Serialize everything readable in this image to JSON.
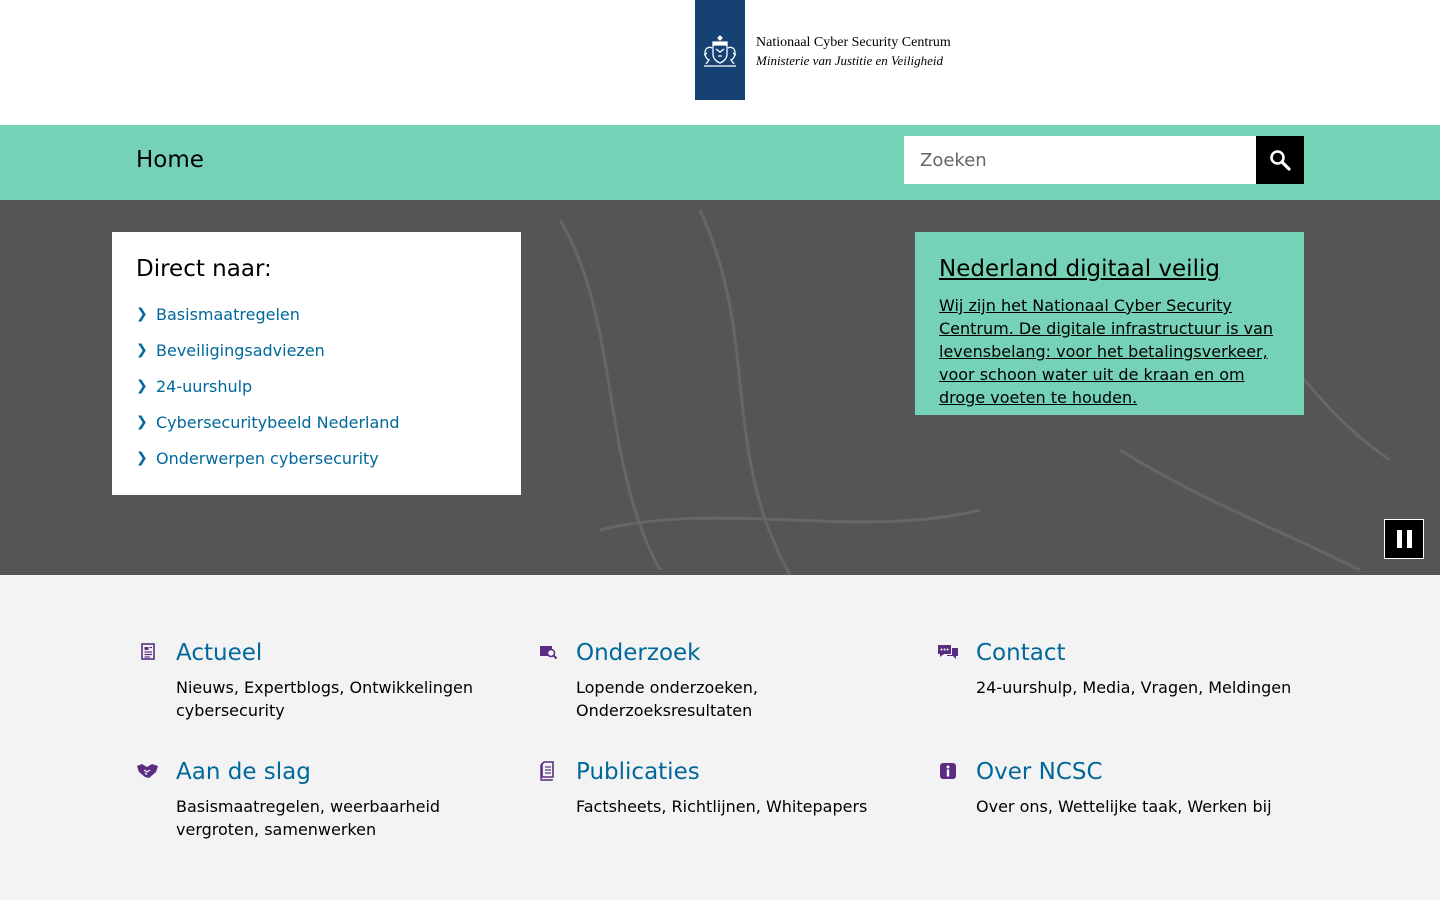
{
  "header": {
    "logo_name": "Nationaal Cyber Security Centrum",
    "logo_ministry": "Ministerie van Justitie en Veiligheid",
    "brand_color": "#154273"
  },
  "nav": {
    "home_label": "Home",
    "search_placeholder": "Zoeken",
    "accent_color": "#76d2b6"
  },
  "direct": {
    "title": "Direct naar:",
    "links": [
      "Basismaatregelen",
      "Beveiligingsadviezen",
      "24-uurshulp",
      "Cybersecuritybeeld Nederland",
      "Onderwerpen cybersecurity"
    ]
  },
  "promo": {
    "title": "Nederland digitaal veilig",
    "text": "Wij zijn het Nationaal Cyber Security Centrum. De digitale infrastructuur is van levensbelang: voor het betalingsverkeer, voor schoon water uit de kraan en om droge voeten te houden."
  },
  "tiles": [
    {
      "icon": "newspaper-icon",
      "title": "Actueel",
      "text": "Nieuws, Expertblogs, Ontwikkelingen cybersecurity"
    },
    {
      "icon": "research-icon",
      "title": "Onderzoek",
      "text": "Lopende onderzoeken, Onderzoeksresultaten"
    },
    {
      "icon": "chat-icon",
      "title": "Contact",
      "text": "24-uurshulp, Media, Vragen, Meldingen"
    },
    {
      "icon": "handshake-icon",
      "title": "Aan de slag",
      "text": "Basismaatregelen, weerbaarheid vergroten, samenwerken"
    },
    {
      "icon": "document-icon",
      "title": "Publicaties",
      "text": "Factsheets, Richtlijnen, Whitepapers"
    },
    {
      "icon": "info-icon",
      "title": "Over NCSC",
      "text": "Over ons, Wettelijke taak, Werken bij"
    }
  ]
}
